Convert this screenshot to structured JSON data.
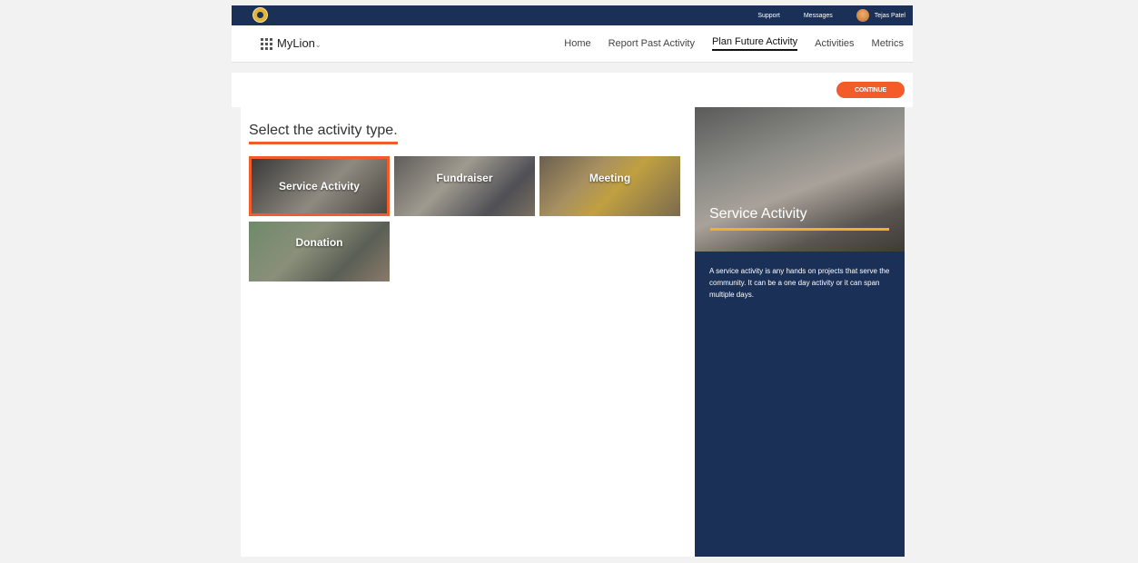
{
  "topbar": {
    "links": [
      "Support",
      "Messages"
    ],
    "user_name": "Tejas Patel"
  },
  "navbar": {
    "brand": "MyLion",
    "links": [
      "Home",
      "Report Past Activity",
      "Plan Future Activity",
      "Activities",
      "Metrics"
    ],
    "active": "Plan Future Activity"
  },
  "actions": {
    "continue_label": "CONTINUE"
  },
  "main": {
    "heading": "Select the activity type.",
    "activity_types": [
      {
        "label": "Service Activity",
        "selected": true
      },
      {
        "label": "Fundraiser",
        "selected": false
      },
      {
        "label": "Meeting",
        "selected": false
      },
      {
        "label": "Donation",
        "selected": false
      }
    ]
  },
  "sidebar": {
    "title": "Service Activity",
    "description": "A service activity is any hands on projects that serve the community. It can be a one day activity or it can span multiple days."
  },
  "colors": {
    "navy": "#1a3057",
    "accent_orange": "#f35b2b",
    "gold": "#f0b22b"
  }
}
